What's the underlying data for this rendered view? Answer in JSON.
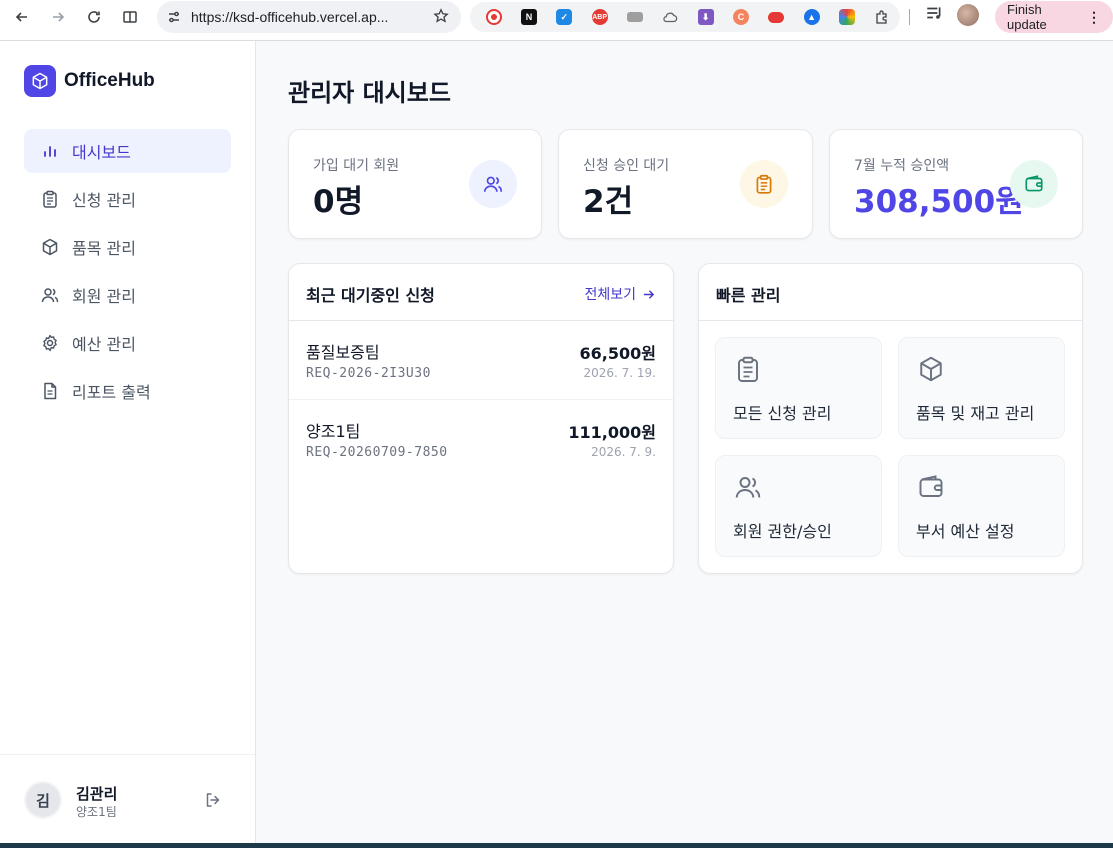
{
  "browser": {
    "url": "https://ksd-officehub.vercel.ap...",
    "finish_update": "Finish update",
    "extensions": [
      "record-icon",
      "notion-icon",
      "v-icon",
      "abp-icon",
      "film-icon",
      "cloud-icon",
      "download-icon",
      "c-icon",
      "ext-red-icon",
      "ext-blue-icon",
      "color-icon",
      "puzzle-icon"
    ]
  },
  "sidebar": {
    "brand": "OfficeHub",
    "items": [
      {
        "label": "대시보드",
        "icon": "bar-chart-icon",
        "active": true
      },
      {
        "label": "신청 관리",
        "icon": "clipboard-icon",
        "active": false
      },
      {
        "label": "품목 관리",
        "icon": "box-icon",
        "active": false
      },
      {
        "label": "회원 관리",
        "icon": "users-icon",
        "active": false
      },
      {
        "label": "예산 관리",
        "icon": "gear-icon",
        "active": false
      },
      {
        "label": "리포트 출력",
        "icon": "document-icon",
        "active": false
      }
    ],
    "user": {
      "initial": "김",
      "name": "김관리",
      "team": "양조1팀"
    }
  },
  "main": {
    "title": "관리자 대시보드",
    "stats": [
      {
        "label": "가입 대기 회원",
        "value": "0명",
        "icon": "users-icon",
        "accent": "#4f46e5",
        "bg": "#eef2ff"
      },
      {
        "label": "신청 승인 대기",
        "value": "2건",
        "icon": "clipboard-icon",
        "accent": "#d97706",
        "bg": "#fef7e6"
      },
      {
        "label": "7월 누적 승인액",
        "value": "308,500원",
        "icon": "wallet-icon",
        "accent": "#059669",
        "bg": "#e7f8f1",
        "value_color": "#4f46e5"
      }
    ],
    "recent": {
      "title": "최근 대기중인 신청",
      "view_all": "전체보기",
      "rows": [
        {
          "team": "품질보증팀",
          "id": "REQ-2026-2I3U30",
          "amount": "66,500원",
          "date": "2026. 7. 19."
        },
        {
          "team": "양조1팀",
          "id": "REQ-20260709-7850",
          "amount": "111,000원",
          "date": "2026. 7. 9."
        }
      ]
    },
    "quick": {
      "title": "빠른 관리",
      "items": [
        {
          "label": "모든 신청 관리",
          "icon": "clipboard-icon"
        },
        {
          "label": "품목 및 재고 관리",
          "icon": "box-icon"
        },
        {
          "label": "회원 권한/승인",
          "icon": "users-icon"
        },
        {
          "label": "부서 예산 설정",
          "icon": "wallet-icon"
        }
      ]
    }
  }
}
